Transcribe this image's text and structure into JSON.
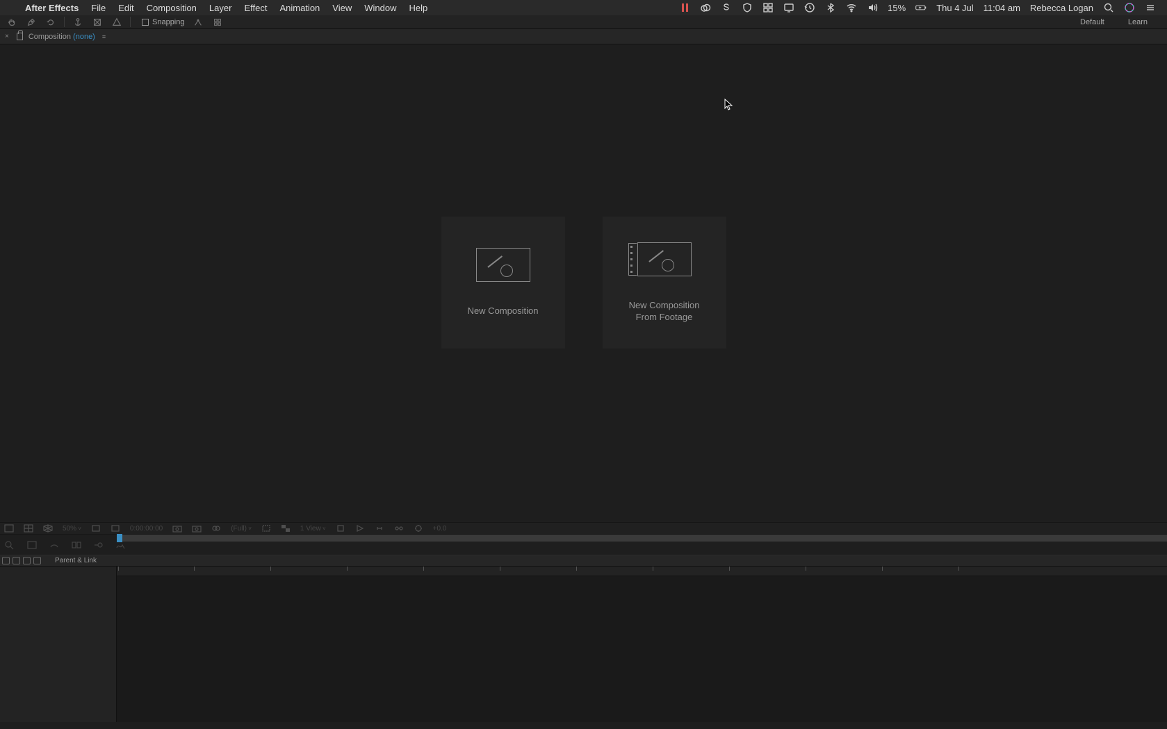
{
  "menubar": {
    "app_name": "After Effects",
    "items": [
      "File",
      "Edit",
      "Composition",
      "Layer",
      "Effect",
      "Animation",
      "View",
      "Window",
      "Help"
    ],
    "battery": "15%",
    "date": "Thu 4 Jul",
    "time": "11:04 am",
    "user": "Rebecca Logan"
  },
  "toolbar": {
    "snapping_label": "Snapping",
    "workspace_default": "Default",
    "workspace_learn": "Learn"
  },
  "panel": {
    "title_prefix": "Composition",
    "title_suffix": "(none)"
  },
  "cards": {
    "new_comp": "New Composition",
    "new_comp_footage_line1": "New Composition",
    "new_comp_footage_line2": "From Footage"
  },
  "viewer_status": {
    "zoom": "50%",
    "timecode": "0:00:00:00",
    "resolution": "(Full)",
    "view_count": "1 View",
    "exposure": "+0.0"
  },
  "timeline": {
    "parent_label": "Parent & Link"
  }
}
